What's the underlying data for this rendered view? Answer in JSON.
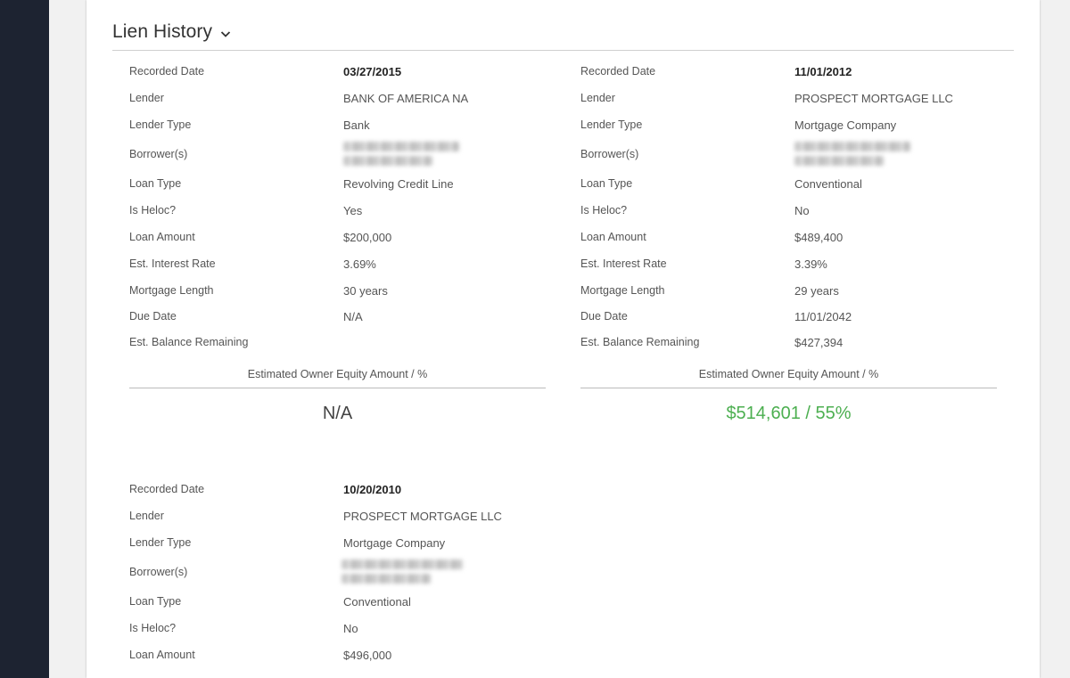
{
  "colors": {
    "sidebar": "#1d2331",
    "equity_positive": "#4caf50"
  },
  "section": {
    "title": "Lien History",
    "toggle_icon": "chevron-down-icon"
  },
  "liens": [
    {
      "rows": [
        {
          "label": "Recorded Date",
          "value": "03/27/2015",
          "bold": true
        },
        {
          "label": "Lender",
          "value": "BANK OF AMERICA NA"
        },
        {
          "label": "Lender Type",
          "value": "Bank"
        },
        {
          "label": "Borrower(s)",
          "value": null,
          "redacted": true
        },
        {
          "label": "Loan Type",
          "value": "Revolving Credit Line"
        },
        {
          "label": "Is Heloc?",
          "value": "Yes"
        },
        {
          "label": "Loan Amount",
          "value": "$200,000"
        },
        {
          "label": "Est. Interest Rate",
          "value": "3.69%"
        },
        {
          "label": "Mortgage Length",
          "value": "30 years"
        },
        {
          "label": "Due Date",
          "value": "N/A"
        },
        {
          "label": "Est. Balance Remaining",
          "value": ""
        }
      ],
      "equity_label": "Estimated Owner Equity Amount / %",
      "equity_value": "N/A"
    },
    {
      "rows": [
        {
          "label": "Recorded Date",
          "value": "11/01/2012",
          "bold": true
        },
        {
          "label": "Lender",
          "value": "PROSPECT MORTGAGE LLC"
        },
        {
          "label": "Lender Type",
          "value": "Mortgage Company"
        },
        {
          "label": "Borrower(s)",
          "value": null,
          "redacted": true
        },
        {
          "label": "Loan Type",
          "value": "Conventional"
        },
        {
          "label": "Is Heloc?",
          "value": "No"
        },
        {
          "label": "Loan Amount",
          "value": "$489,400"
        },
        {
          "label": "Est. Interest Rate",
          "value": "3.39%"
        },
        {
          "label": "Mortgage Length",
          "value": "29 years"
        },
        {
          "label": "Due Date",
          "value": "11/01/2042"
        },
        {
          "label": "Est. Balance Remaining",
          "value": "$427,394"
        }
      ],
      "equity_label": "Estimated Owner Equity Amount / %",
      "equity_value": "$514,601 / 55%"
    },
    {
      "rows": [
        {
          "label": "Recorded Date",
          "value": "10/20/2010",
          "bold": true
        },
        {
          "label": "Lender",
          "value": "PROSPECT MORTGAGE LLC"
        },
        {
          "label": "Lender Type",
          "value": "Mortgage Company"
        },
        {
          "label": "Borrower(s)",
          "value": null,
          "redacted": true
        },
        {
          "label": "Loan Type",
          "value": "Conventional"
        },
        {
          "label": "Is Heloc?",
          "value": "No"
        },
        {
          "label": "Loan Amount",
          "value": "$496,000"
        }
      ]
    }
  ]
}
